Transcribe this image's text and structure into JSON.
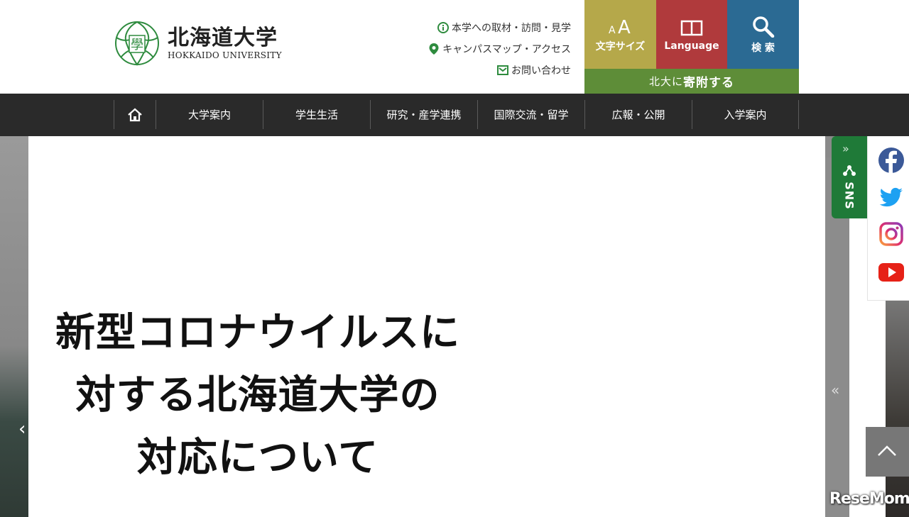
{
  "logo": {
    "name_ja": "北海道大学",
    "name_en": "HOKKAIDO UNIVERSITY"
  },
  "quicklinks": [
    {
      "label": "本学への取材・訪問・見学",
      "icon": "info-icon"
    },
    {
      "label": "キャンパスマップ・アクセス",
      "icon": "map-pin-icon"
    },
    {
      "label": "お問い合わせ",
      "icon": "mail-icon"
    }
  ],
  "tiles": {
    "font_size": "文字サイズ",
    "language": "Language",
    "search": "検 索",
    "donate_prefix": "北大に",
    "donate_main": "寄附する"
  },
  "nav": {
    "items": [
      "大学案内",
      "学生生活",
      "研究・産学連携",
      "国際交流・留学",
      "広報・公開",
      "入学案内"
    ]
  },
  "hero": {
    "lines": [
      "新型コロナウイルスに",
      "対する北海道大学の",
      "対応について"
    ]
  },
  "sns": {
    "label": "SNS",
    "services": [
      "facebook",
      "twitter",
      "instagram",
      "youtube"
    ]
  },
  "watermark": "ReseMom",
  "colors": {
    "font_tile": "#b5a84a",
    "lang_tile": "#b03a3c",
    "search_tile": "#2b6a93",
    "donate": "#5e8d38",
    "nav": "#2a2a2a",
    "sns": "#1f7a38"
  }
}
